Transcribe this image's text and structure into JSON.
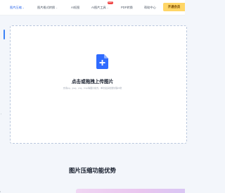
{
  "nav": {
    "items": [
      {
        "label": "图片压缩",
        "has_caret": true,
        "active": true
      },
      {
        "label": "图片格式转换",
        "has_caret": true,
        "active": false
      },
      {
        "label": "AI抠图",
        "has_caret": false,
        "active": false
      },
      {
        "label": "AI图片工具",
        "has_caret": true,
        "active": false
      },
      {
        "label": "PDF转换",
        "has_caret": false,
        "active": false
      },
      {
        "label": "帮助中心",
        "has_caret": false,
        "active": false
      }
    ],
    "hot_badge": "HOT",
    "vip_label": "开通会员",
    "caret_glyph": "⌄"
  },
  "upload": {
    "title": "点击或拖拽上传图片",
    "hint": "支持jpg、jpeg、png、bmp等图片格式，单次最多批量处理20张",
    "icon": "file-plus-icon",
    "accent": "#2f6bff"
  },
  "features": {
    "title": "图片压缩功能优势"
  },
  "colors": {
    "accent": "#2563eb",
    "vip": "#ffd666",
    "badge": "#ef4444"
  }
}
